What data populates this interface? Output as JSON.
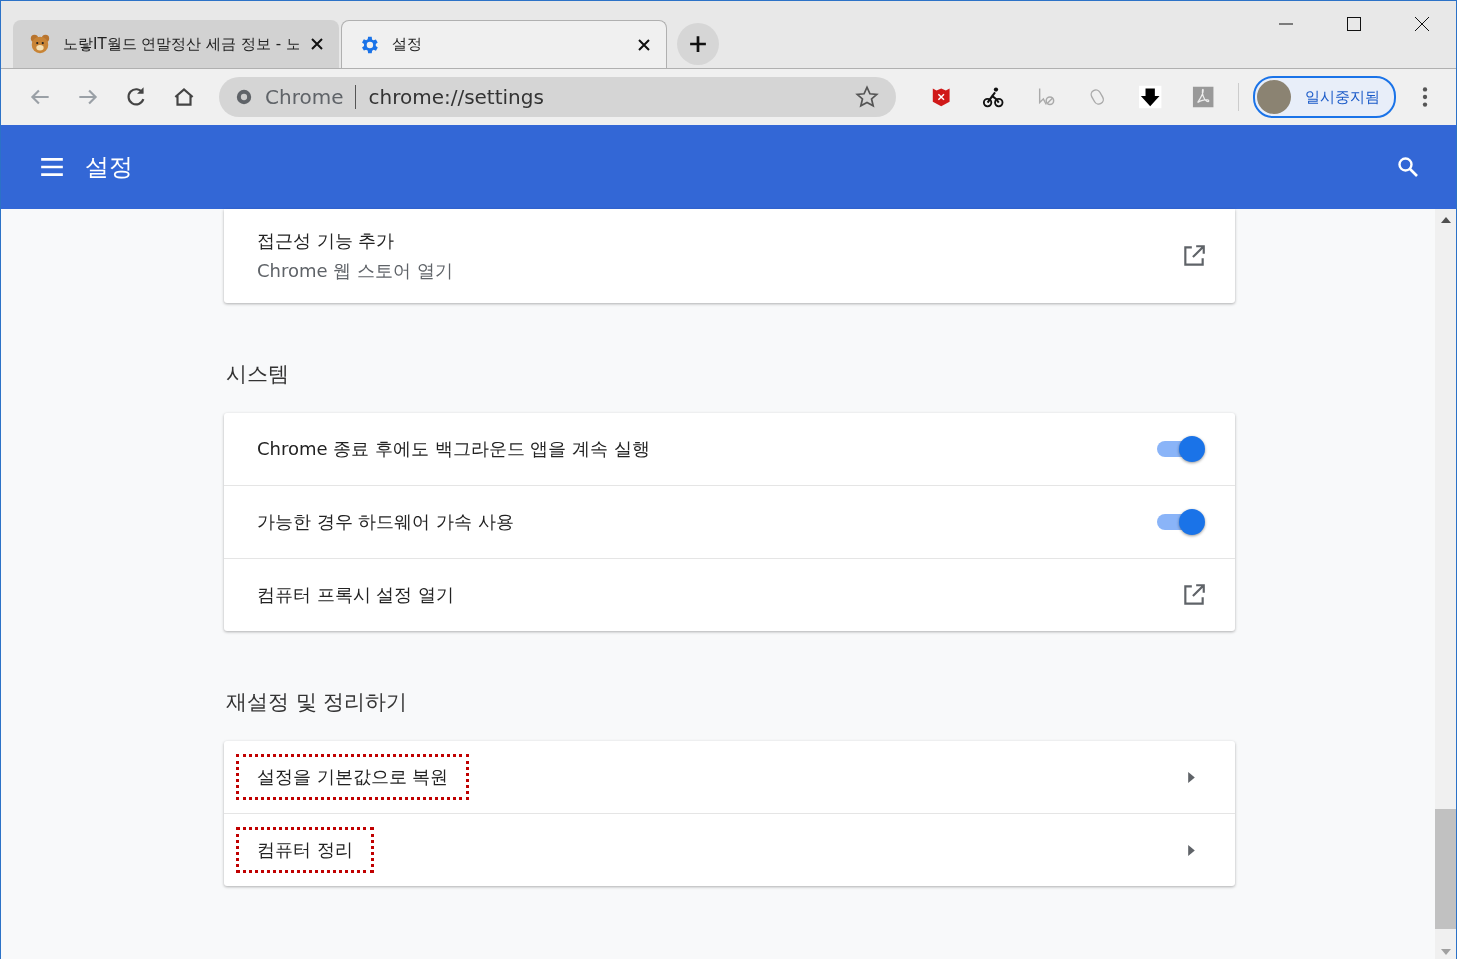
{
  "tabs": [
    {
      "title": "노랗IT월드 연말정산 세금 정보 - 노",
      "selected": false
    },
    {
      "title": "설정",
      "selected": true
    }
  ],
  "address_bar": {
    "site": "Chrome",
    "url": "chrome://settings"
  },
  "profile": {
    "label": "일시중지됨"
  },
  "header": {
    "title": "설정"
  },
  "sections": [
    {
      "rows": [
        {
          "kind": "link",
          "title": "접근성 기능 추가",
          "subtitle": "Chrome 웹 스토어 열기",
          "marked": false
        }
      ]
    },
    {
      "heading": "시스템",
      "rows": [
        {
          "kind": "toggle",
          "title": "Chrome 종료 후에도 백그라운드 앱을 계속 실행",
          "on": true,
          "marked": false
        },
        {
          "kind": "toggle",
          "title": "가능한 경우 하드웨어 가속 사용",
          "on": true,
          "marked": false
        },
        {
          "kind": "link",
          "title": "컴퓨터 프록시 설정 열기",
          "marked": false
        }
      ]
    },
    {
      "heading": "재설정 및 정리하기",
      "rows": [
        {
          "kind": "arrow",
          "title": "설정을 기본값으로 복원",
          "marked": true
        },
        {
          "kind": "arrow",
          "title": "컴퓨터 정리",
          "marked": true
        }
      ]
    }
  ]
}
